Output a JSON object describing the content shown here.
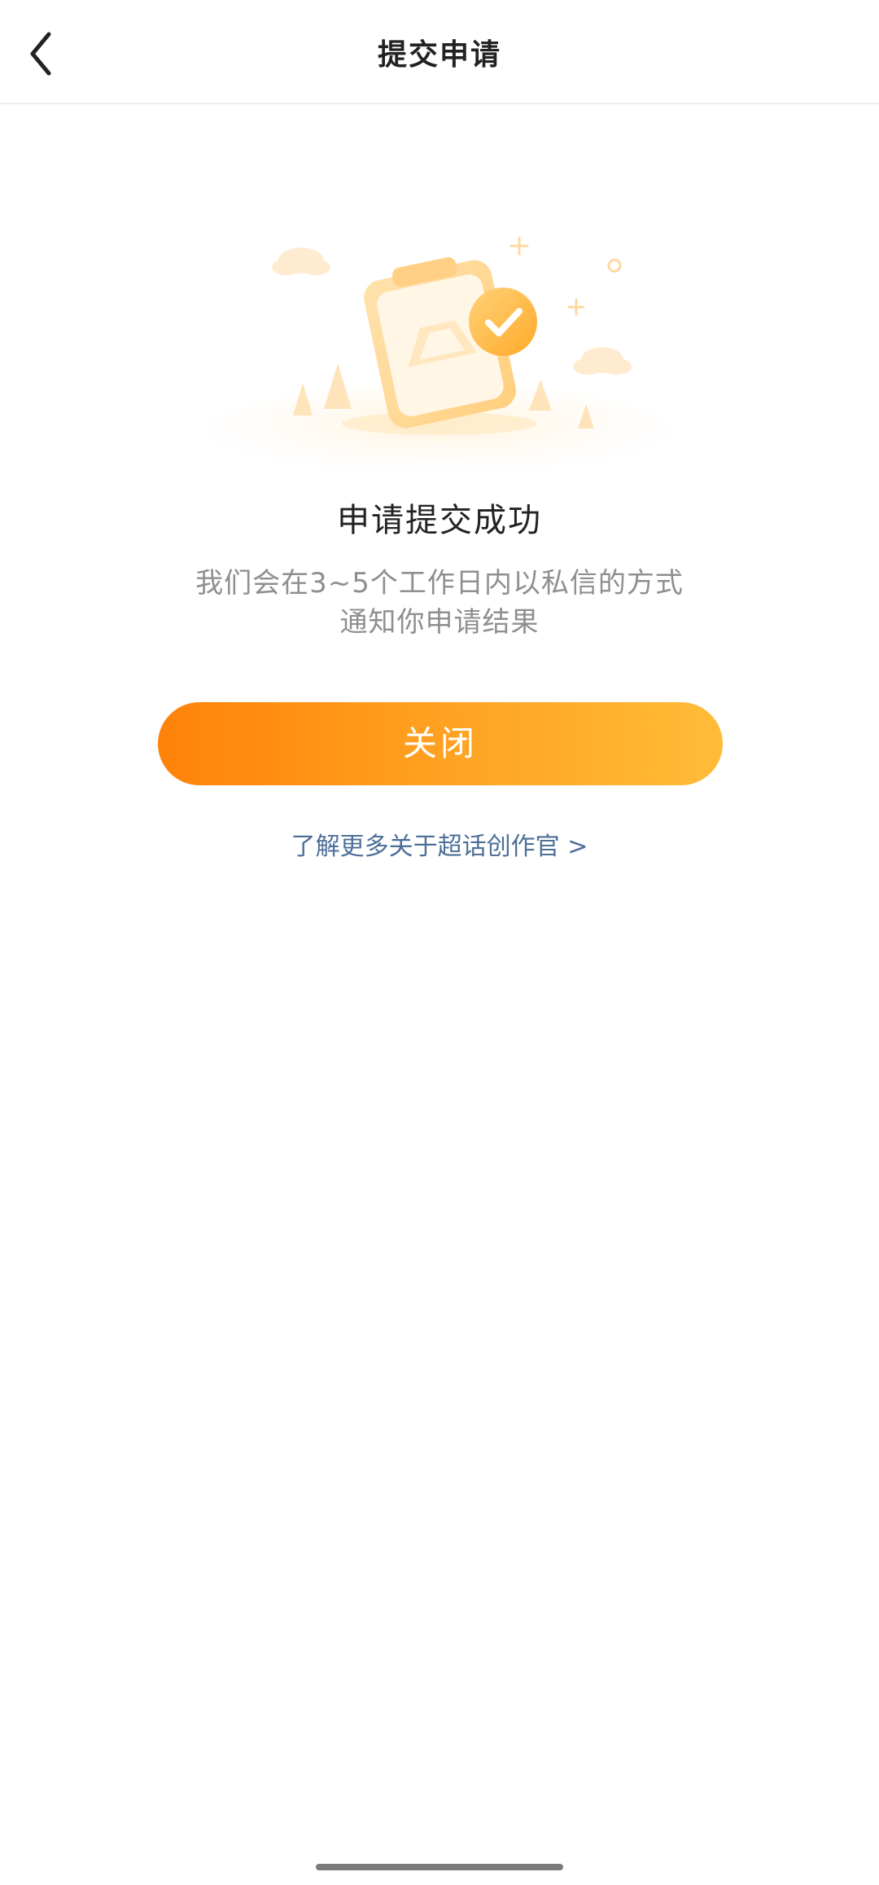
{
  "header": {
    "title": "提交申请",
    "back_icon": "chevron-left-icon"
  },
  "illustration": {
    "name": "clipboard-success-illustration",
    "accent_color": "#ffb840"
  },
  "result": {
    "title": "申请提交成功",
    "description_line1": "我们会在3~5个工作日内以私信的方式",
    "description_line2": "通知你申请结果"
  },
  "actions": {
    "close_label": "关闭",
    "learn_more_label": "了解更多关于超话创作官 >"
  },
  "colors": {
    "button_gradient_start": "#ff820a",
    "button_gradient_end": "#ffbc38",
    "link": "#4d6f98",
    "description": "#8f8f8f"
  }
}
